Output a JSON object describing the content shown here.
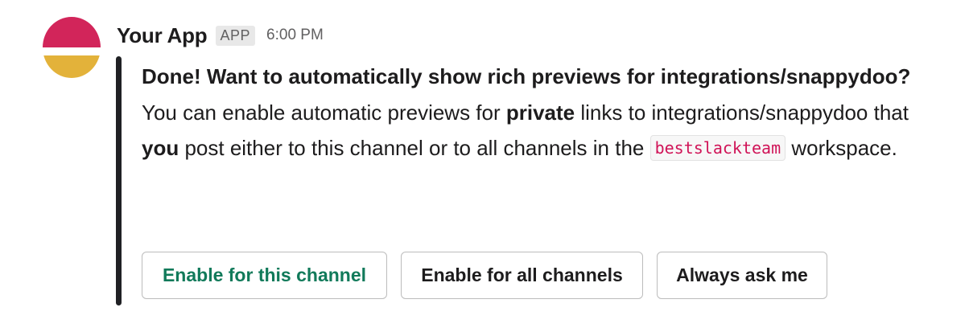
{
  "message": {
    "app_name": "Your App",
    "app_badge": "APP",
    "timestamp": "6:00 PM",
    "avatar_colors": {
      "top": "#d2255a",
      "bottom": "#e3b23a"
    },
    "attachment": {
      "title": "Done! Want to automatically show rich previews for integrations/snappydoo?",
      "body": {
        "part1": "You can enable automatic previews for ",
        "bold1": "private",
        "part2": " links to integrations/snappydoo that ",
        "bold2": "you",
        "part3": " post either to this channel or to all channels in the ",
        "code": "bestslackteam",
        "part4": " workspace."
      },
      "bar_color": "#202124"
    },
    "buttons": [
      {
        "label": "Enable for this channel",
        "style": "primary",
        "color": "#117a5a"
      },
      {
        "label": "Enable for all channels",
        "style": "default"
      },
      {
        "label": "Always ask me",
        "style": "default"
      }
    ]
  }
}
